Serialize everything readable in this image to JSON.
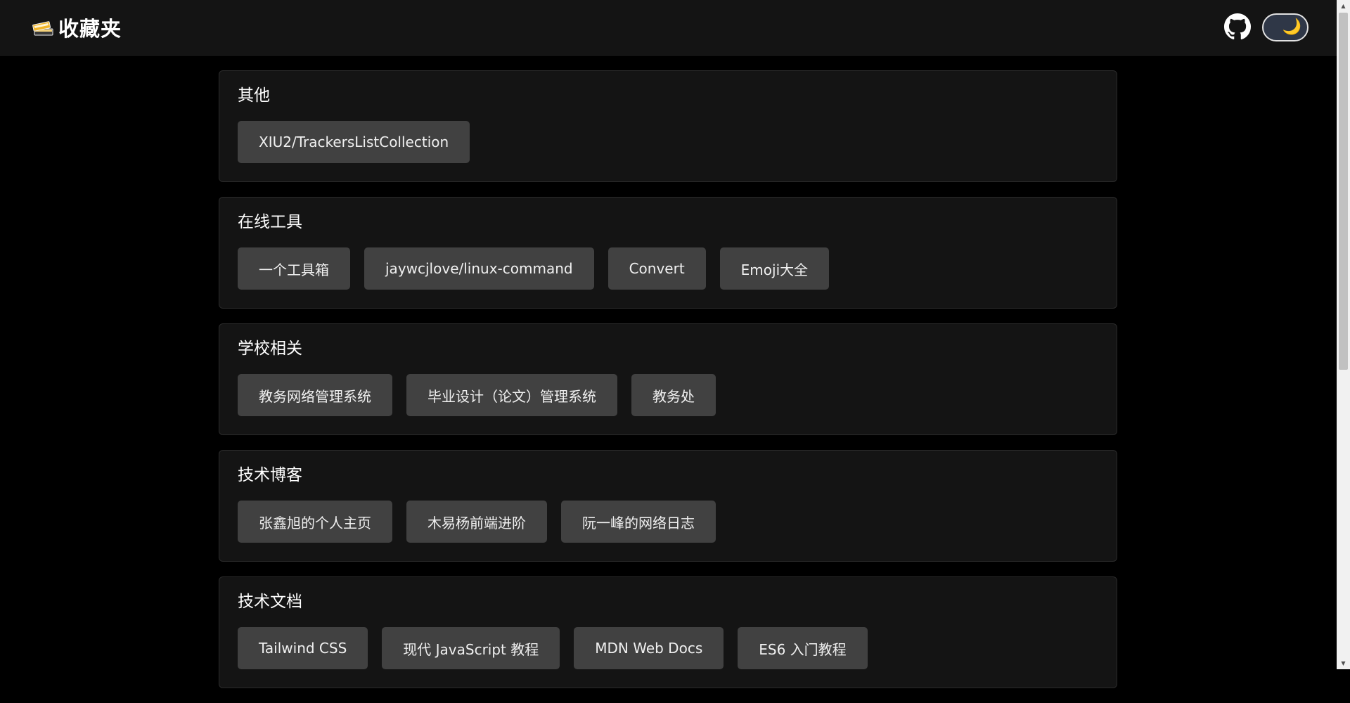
{
  "header": {
    "logo_icon": "books-stack-icon",
    "title": "收藏夹",
    "github_icon": "github-icon",
    "theme_toggle": {
      "icon": "moon-icon",
      "symbol": "🌙"
    }
  },
  "sections": [
    {
      "title": "其他",
      "links": [
        "XIU2/TrackersListCollection"
      ]
    },
    {
      "title": "在线工具",
      "links": [
        "一个工具箱",
        "jaywcjlove/linux-command",
        "Convert",
        "Emoji大全"
      ]
    },
    {
      "title": "学校相关",
      "links": [
        "教务网络管理系统",
        "毕业设计（论文）管理系统",
        "教务处"
      ]
    },
    {
      "title": "技术博客",
      "links": [
        "张鑫旭的个人主页",
        "木易杨前端进阶",
        "阮一峰的网络日志"
      ]
    },
    {
      "title": "技术文档",
      "links": [
        "Tailwind CSS",
        "现代 JavaScript 教程",
        "MDN Web Docs",
        "ES6 入门教程"
      ]
    }
  ],
  "colors": {
    "page_bg": "#000000",
    "header_bg": "#141414",
    "card_bg": "#141414",
    "button_bg": "#414141",
    "toggle_bg": "#2f3747"
  }
}
